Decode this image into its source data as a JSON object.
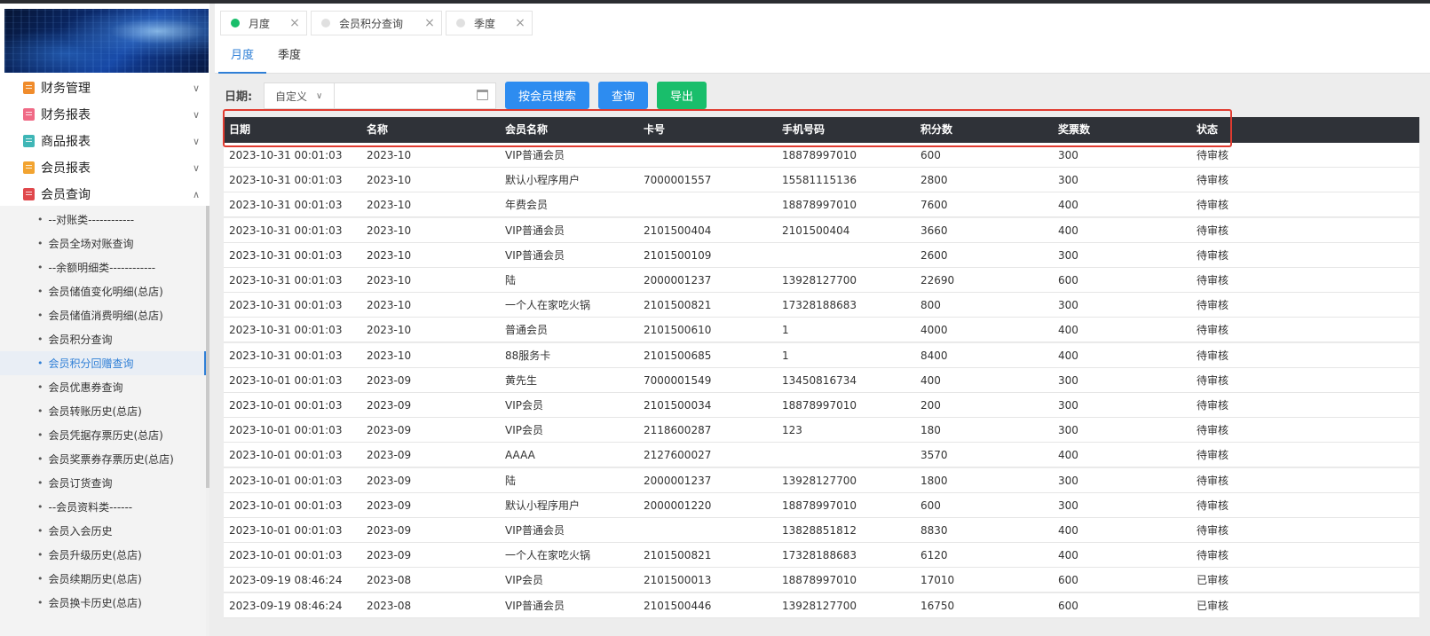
{
  "colors": {
    "accent": "#2f7fd6",
    "button_blue": "#2d8cf0",
    "button_green": "#19be6b",
    "table_header": "#2f3238",
    "highlight": "#e03b30"
  },
  "sidebar": {
    "menu": [
      {
        "label": "财务管理",
        "icon": "calculator-icon",
        "color": "#f08c2c",
        "expanded": false
      },
      {
        "label": "财务报表",
        "icon": "report-icon",
        "color": "#f06a86",
        "expanded": false
      },
      {
        "label": "商品报表",
        "icon": "report-icon",
        "color": "#3fb6b6",
        "expanded": false
      },
      {
        "label": "会员报表",
        "icon": "report-icon",
        "color": "#f2a431",
        "expanded": false
      },
      {
        "label": "会员查询",
        "icon": "book-icon",
        "color": "#e0484c",
        "expanded": true
      }
    ],
    "submenu": [
      {
        "label": "--对账类------------"
      },
      {
        "label": "会员全场对账查询"
      },
      {
        "label": "--余额明细类------------"
      },
      {
        "label": "会员储值变化明细(总店)"
      },
      {
        "label": "会员储值消费明细(总店)"
      },
      {
        "label": "会员积分查询"
      },
      {
        "label": "会员积分回赠查询",
        "active": true
      },
      {
        "label": "会员优惠券查询"
      },
      {
        "label": "会员转账历史(总店)"
      },
      {
        "label": "会员凭据存票历史(总店)"
      },
      {
        "label": "会员奖票券存票历史(总店)"
      },
      {
        "label": "会员订货查询"
      },
      {
        "label": "--会员资料类------"
      },
      {
        "label": "会员入会历史"
      },
      {
        "label": "会员升级历史(总店)"
      },
      {
        "label": "会员续期历史(总店)"
      },
      {
        "label": "会员换卡历史(总店)"
      }
    ]
  },
  "page_tabs": [
    {
      "label": "月度",
      "dot_color": "#19be6b"
    },
    {
      "label": "会员积分查询",
      "dot_color": "#e0e0e0"
    },
    {
      "label": "季度",
      "dot_color": "#e0e0e0"
    }
  ],
  "sub_tabs": [
    {
      "label": "月度",
      "active": true
    },
    {
      "label": "季度",
      "active": false
    }
  ],
  "filter": {
    "date_label": "日期:",
    "range_select": "自定义",
    "date_value": "",
    "buttons": {
      "search_by_member": "按会员搜索",
      "query": "查询",
      "export": "导出"
    }
  },
  "table": {
    "columns": [
      "日期",
      "名称",
      "会员名称",
      "卡号",
      "手机号码",
      "积分数",
      "奖票数",
      "状态"
    ],
    "rows": [
      [
        "2023-10-31 00:01:03",
        "2023-10",
        "VIP普通会员",
        "",
        "18878997010",
        "600",
        "300",
        "待审核"
      ],
      [
        "2023-10-31 00:01:03",
        "2023-10",
        "默认小程序用户",
        "7000001557",
        "15581115136",
        "2800",
        "300",
        "待审核"
      ],
      [
        "2023-10-31 00:01:03",
        "2023-10",
        "年费会员",
        "",
        "18878997010",
        "7600",
        "400",
        "待审核"
      ],
      [
        "2023-10-31 00:01:03",
        "2023-10",
        "VIP普通会员",
        "2101500404",
        "2101500404",
        "3660",
        "400",
        "待审核"
      ],
      [
        "2023-10-31 00:01:03",
        "2023-10",
        "VIP普通会员",
        "2101500109",
        "",
        "2600",
        "300",
        "待审核"
      ],
      [
        "2023-10-31 00:01:03",
        "2023-10",
        "陆",
        "2000001237",
        "13928127700",
        "22690",
        "600",
        "待审核"
      ],
      [
        "2023-10-31 00:01:03",
        "2023-10",
        "一个人在家吃火锅",
        "2101500821",
        "17328188683",
        "800",
        "300",
        "待审核"
      ],
      [
        "2023-10-31 00:01:03",
        "2023-10",
        "普通会员",
        "2101500610",
        "1",
        "4000",
        "400",
        "待审核"
      ],
      [
        "2023-10-31 00:01:03",
        "2023-10",
        "88服务卡",
        "2101500685",
        "1",
        "8400",
        "400",
        "待审核"
      ],
      [
        "2023-10-01 00:01:03",
        "2023-09",
        "黄先生",
        "7000001549",
        "13450816734",
        "400",
        "300",
        "待审核"
      ],
      [
        "2023-10-01 00:01:03",
        "2023-09",
        "VIP会员",
        "2101500034",
        "18878997010",
        "200",
        "300",
        "待审核"
      ],
      [
        "2023-10-01 00:01:03",
        "2023-09",
        "VIP会员",
        "2118600287",
        "123",
        "180",
        "300",
        "待审核"
      ],
      [
        "2023-10-01 00:01:03",
        "2023-09",
        "AAAA",
        "2127600027",
        "",
        "3570",
        "400",
        "待审核"
      ],
      [
        "2023-10-01 00:01:03",
        "2023-09",
        "陆",
        "2000001237",
        "13928127700",
        "1800",
        "300",
        "待审核"
      ],
      [
        "2023-10-01 00:01:03",
        "2023-09",
        "默认小程序用户",
        "2000001220",
        "18878997010",
        "600",
        "300",
        "待审核"
      ],
      [
        "2023-10-01 00:01:03",
        "2023-09",
        "VIP普通会员",
        "",
        "13828851812",
        "8830",
        "400",
        "待审核"
      ],
      [
        "2023-10-01 00:01:03",
        "2023-09",
        "一个人在家吃火锅",
        "2101500821",
        "17328188683",
        "6120",
        "400",
        "待审核"
      ],
      [
        "2023-09-19 08:46:24",
        "2023-08",
        "VIP会员",
        "2101500013",
        "18878997010",
        "17010",
        "600",
        "已审核"
      ],
      [
        "2023-09-19 08:46:24",
        "2023-08",
        "VIP普通会员",
        "2101500446",
        "13928127700",
        "16750",
        "600",
        "已审核"
      ]
    ]
  }
}
